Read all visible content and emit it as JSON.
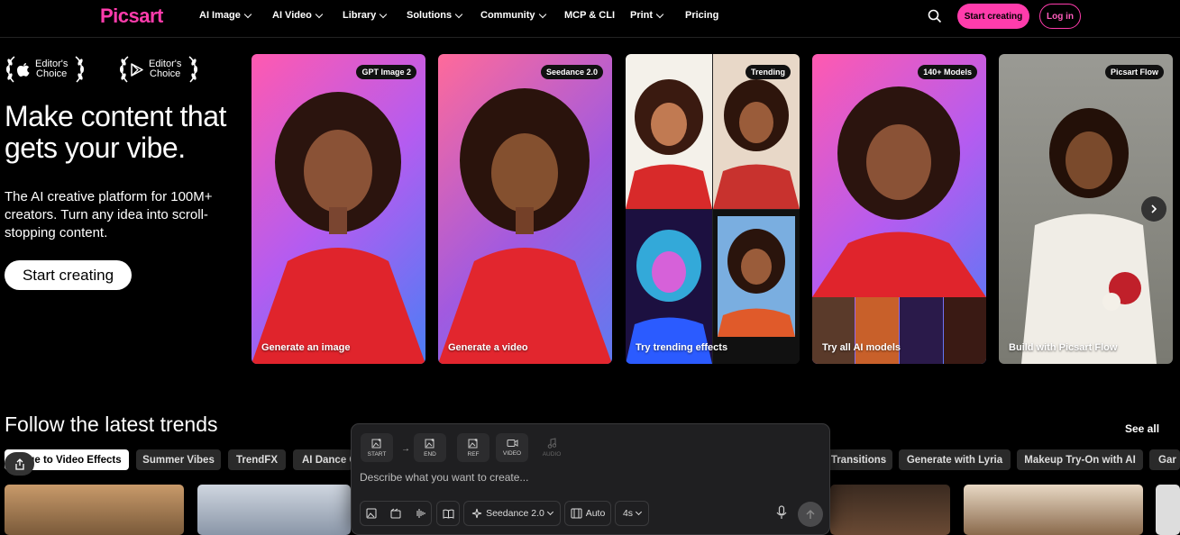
{
  "nav": {
    "logo": "Picsart",
    "items": [
      {
        "label": "AI Image",
        "has_dropdown": true
      },
      {
        "label": "AI Video",
        "has_dropdown": true
      },
      {
        "label": "Library",
        "has_dropdown": true
      },
      {
        "label": "Solutions",
        "has_dropdown": true
      },
      {
        "label": "Community",
        "has_dropdown": true
      },
      {
        "label": "MCP & CLI",
        "has_dropdown": false
      },
      {
        "label": "Print",
        "has_dropdown": true
      },
      {
        "label": "Pricing",
        "has_dropdown": false
      }
    ],
    "search_icon": "search-icon",
    "start_button": "Start creating",
    "login_button": "Log in"
  },
  "hero": {
    "awards": [
      {
        "icon": "apple-icon",
        "line1": "Editor's",
        "line2": "Choice"
      },
      {
        "icon": "play-store-icon",
        "line1": "Editor's",
        "line2": "Choice"
      }
    ],
    "title": "Make content that gets your vibe.",
    "subtitle": "The AI creative platform for 100M+ creators. Turn any idea into scroll-stopping content.",
    "cta": "Start creating"
  },
  "cards": [
    {
      "badge": "GPT Image 2",
      "label": "Generate an image"
    },
    {
      "badge": "Seedance 2.0",
      "label": "Generate a video"
    },
    {
      "badge": "Trending",
      "label": "Try trending effects"
    },
    {
      "badge": "140+ Models",
      "label": "Try all AI models"
    },
    {
      "badge": "Picsart Flow",
      "label": "Build with Picsart Flow"
    }
  ],
  "trends": {
    "title": "Follow the latest trends",
    "see_all": "See all",
    "pills": [
      "ge to Video Effects",
      "Summer Vibes",
      "TrendFX",
      "AI Dance C",
      "Transitions",
      "Generate with Lyria",
      "Makeup Try-On with AI",
      "Gar"
    ]
  },
  "composer": {
    "tools": [
      {
        "label": "START",
        "icon": "image-add-icon"
      },
      {
        "label": "END",
        "icon": "image-add-icon"
      },
      {
        "label": "REF",
        "icon": "image-add-icon"
      },
      {
        "label": "VIDEO",
        "icon": "video-icon"
      },
      {
        "label": "AUDIO",
        "icon": "music-icon"
      }
    ],
    "placeholder": "Describe what you want to create...",
    "model": "Seedance 2.0",
    "aspect": "Auto",
    "duration": "4s"
  },
  "colors": {
    "brand": "#ff3cac",
    "background": "#000000"
  }
}
